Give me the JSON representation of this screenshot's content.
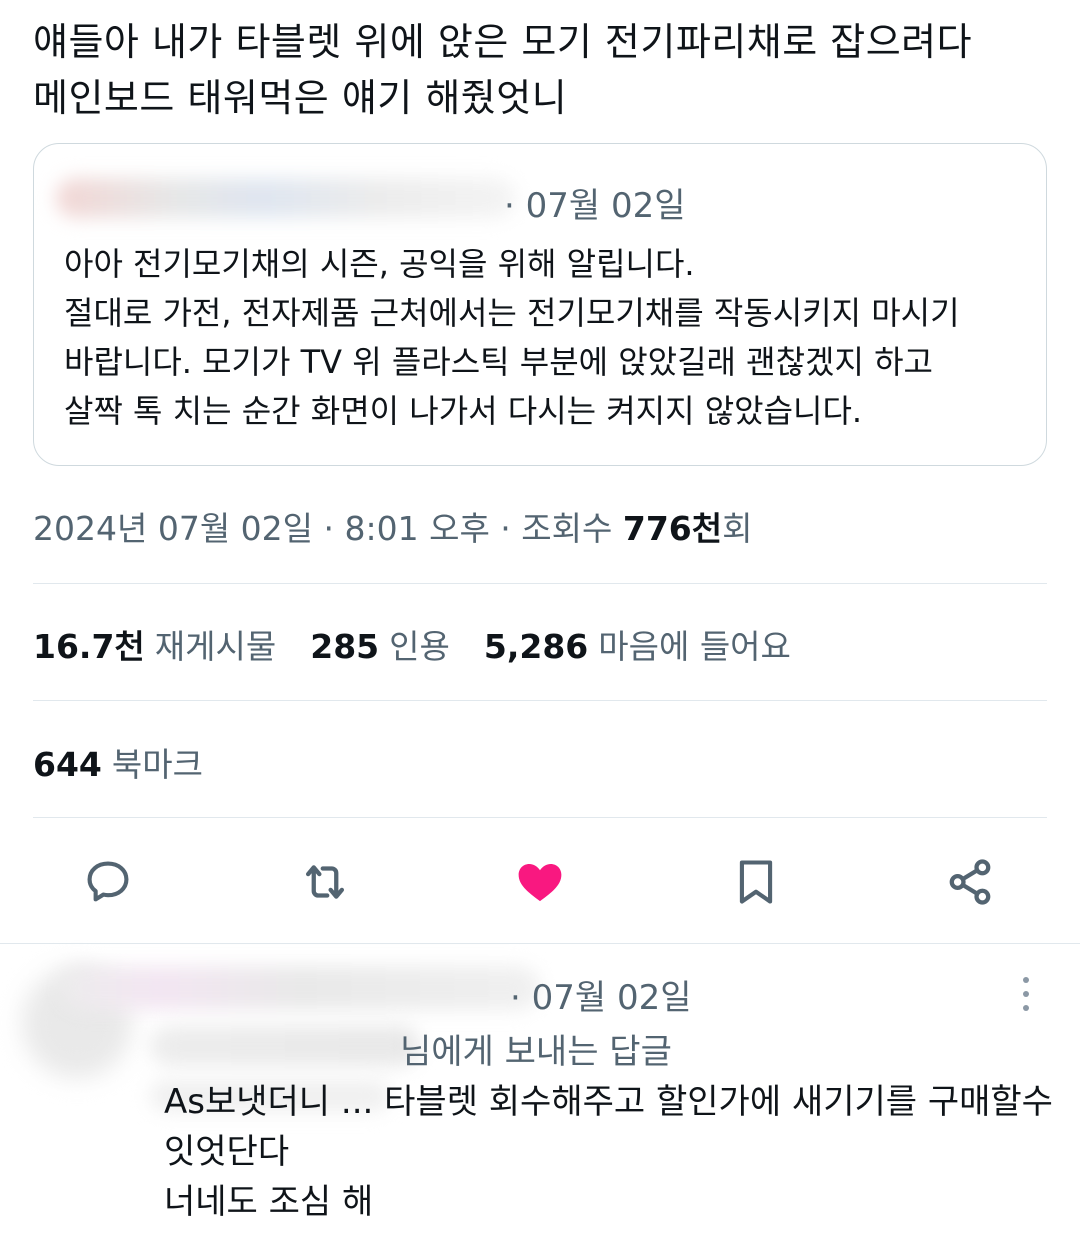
{
  "post": {
    "text_line1": "얘들아 내가 타블렛 위에 앉은 모기 전기파리채로 잡으려다",
    "text_line2": "메인보드 태워먹은 얘기 해줬엇니"
  },
  "quote": {
    "date": "· 07월 02일",
    "lines": [
      "아아 전기모기채의 시즌, 공익을 위해 알립니다.",
      "절대로 가전, 전자제품 근처에서는 전기모기채를 작동시키지 마시기",
      "바랍니다. 모기가 TV 위 플라스틱 부분에 앉았길래 괜찮겠지 하고",
      "살짝 톡 치는 순간 화면이 나가서 다시는 켜지지 않았습니다."
    ]
  },
  "meta": {
    "datetime": "2024년 07월 02일 · 8:01 오후 · 조회수 ",
    "views": "776천",
    "views_suffix": "회"
  },
  "stats": {
    "reposts_count": "16.7천",
    "reposts_label": "재게시물",
    "quotes_count": "285",
    "quotes_label": "인용",
    "likes_count": "5,286",
    "likes_label": "마음에 들어요"
  },
  "bookmarks": {
    "count": "644",
    "label": "북마크"
  },
  "actions": {
    "reply_icon": "reply-icon",
    "repost_icon": "repost-icon",
    "like_icon": "heart-icon",
    "bookmark_icon": "bookmark-icon",
    "share_icon": "share-icon",
    "like_color": "#f91880",
    "icon_color": "#536471"
  },
  "reply": {
    "date": "07월 02일",
    "replying_to": "님에게 보내는 답글",
    "lines": [
      "As보냇더니 ... 타블렛 회수해주고 할인가에 새기기를 구매할수",
      "잇엇단다",
      "너네도 조심 해"
    ]
  }
}
